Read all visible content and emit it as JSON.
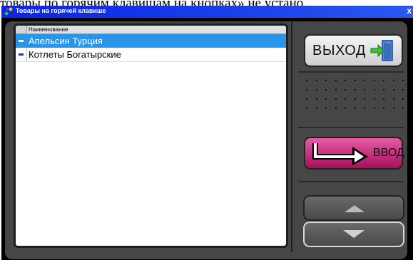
{
  "background": {
    "text": "товары по горячим клавишам на кнопках» не устано"
  },
  "window": {
    "title": "Товары на горячей клавише",
    "close_glyph": "x"
  },
  "grid": {
    "column_header": "Наименование",
    "rows": [
      {
        "label": "Апельсин Турция",
        "selected": true
      },
      {
        "label": "Котлеты Богатырские",
        "selected": false
      }
    ]
  },
  "buttons": {
    "exit_label": "ВЫХОД",
    "enter_label": "ВВОД"
  },
  "colors": {
    "title_bar": "#0a24e8",
    "selection": "#2a95e8",
    "enter_button": "#c8287a",
    "frame": "#464646"
  },
  "icons": {
    "title": "app-icon",
    "exit": "door-exit-icon",
    "enter": "return-arrow-icon",
    "up": "arrow-up-icon",
    "down": "arrow-down-icon"
  }
}
